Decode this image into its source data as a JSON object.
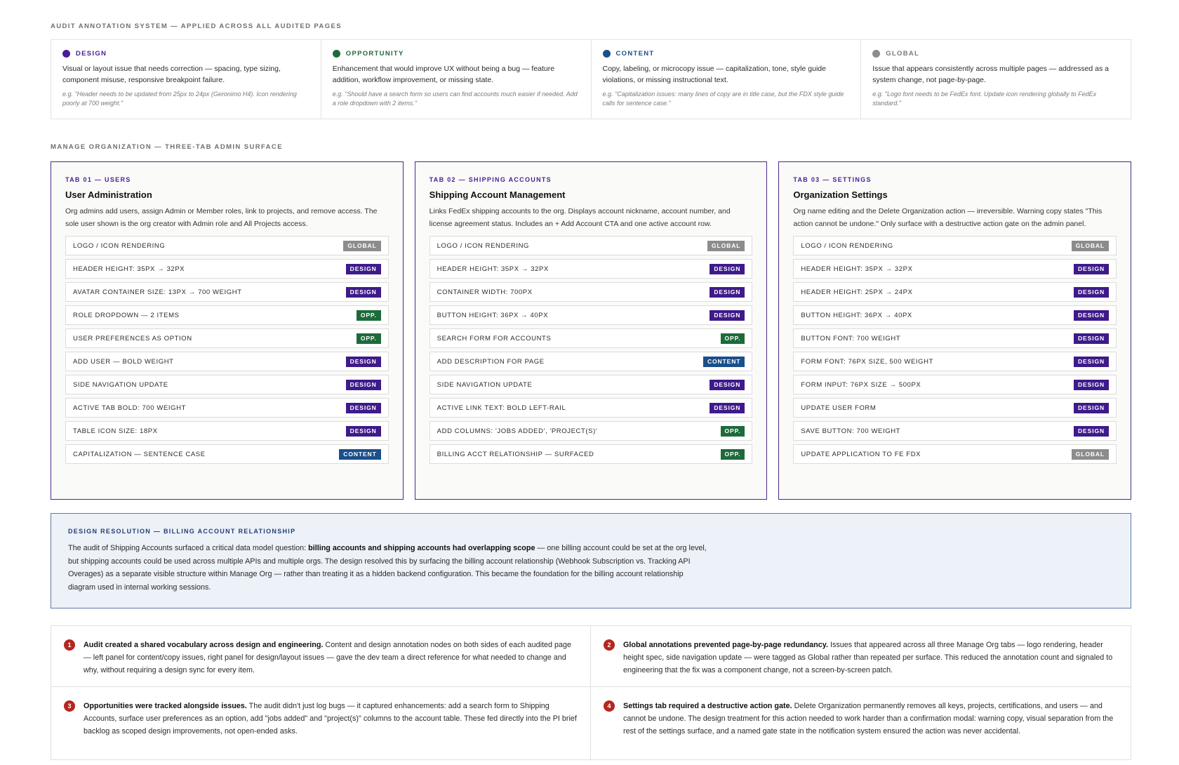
{
  "legend": {
    "section_label": "AUDIT ANNOTATION SYSTEM — APPLIED ACROSS ALL AUDITED PAGES",
    "items": [
      {
        "title": "DESIGN",
        "color": "#4a1d96",
        "desc": "Visual or layout issue that needs correction — spacing, type sizing, component misuse, responsive breakpoint failure.",
        "example": "e.g. \"Header needs to be updated from 25px to 24px (Geronimo H4). Icon rendering poorly at 700 weight.\""
      },
      {
        "title": "OPPORTUNITY",
        "color": "#1d6b3a",
        "desc": "Enhancement that would improve UX without being a bug — feature addition, workflow improvement, or missing state.",
        "example": "e.g. \"Should have a search form so users can find accounts much easier if needed. Add a role dropdown with 2 items.\""
      },
      {
        "title": "CONTENT",
        "color": "#1b4f8a",
        "desc": "Copy, labeling, or microcopy issue — capitalization, tone, style guide violations, or missing instructional text.",
        "example": "e.g. \"Capitalization issues: many lines of copy are in title case, but the FDX style guide calls for sentence case.\""
      },
      {
        "title": "GLOBAL",
        "color": "#8c8c8c",
        "desc": "Issue that appears consistently across multiple pages — addressed as a system change, not page-by-page.",
        "example": "e.g. \"Logo font needs to be FedEx font. Update icon rendering globally to FedEx standard.\""
      }
    ]
  },
  "manage": {
    "section_label": "MANAGE ORGANIZATION — THREE-TAB ADMIN SURFACE",
    "tabs": [
      {
        "kicker": "TAB 01 — USERS",
        "title": "User Administration",
        "desc": "Org admins add users, assign Admin or Member roles, link to projects, and remove access. The sole user shown is the org creator with Admin role and All Projects access.",
        "issues": [
          {
            "label": "LOGO / ICON RENDERING",
            "badge": "GLOBAL",
            "type": "global"
          },
          {
            "label": "HEADER HEIGHT: 35PX → 32PX",
            "badge": "DESIGN",
            "type": "design"
          },
          {
            "label": "AVATAR CONTAINER SIZE: 13PX → 700 WEIGHT",
            "badge": "DESIGN",
            "type": "design"
          },
          {
            "label": "ROLE DROPDOWN — 2 ITEMS",
            "badge": "OPP.",
            "type": "opp"
          },
          {
            "label": "USER PREFERENCES AS OPTION",
            "badge": "OPP.",
            "type": "opp"
          },
          {
            "label": "ADD USER — BOLD WEIGHT",
            "badge": "DESIGN",
            "type": "design"
          },
          {
            "label": "SIDE NAVIGATION UPDATE",
            "badge": "DESIGN",
            "type": "design"
          },
          {
            "label": "ACTIVE TAB BOLD: 700 WEIGHT",
            "badge": "DESIGN",
            "type": "design"
          },
          {
            "label": "TABLE ICON SIZE: 18PX",
            "badge": "DESIGN",
            "type": "design"
          },
          {
            "label": "CAPITALIZATION — SENTENCE CASE",
            "badge": "CONTENT",
            "type": "content"
          }
        ]
      },
      {
        "kicker": "TAB 02 — SHIPPING ACCOUNTS",
        "title": "Shipping Account Management",
        "desc": "Links FedEx shipping accounts to the org. Displays account nickname, account number, and license agreement status. Includes an + Add Account CTA and one active account row.",
        "issues": [
          {
            "label": "LOGO / ICON RENDERING",
            "badge": "GLOBAL",
            "type": "global"
          },
          {
            "label": "HEADER HEIGHT: 35PX → 32PX",
            "badge": "DESIGN",
            "type": "design"
          },
          {
            "label": "CONTAINER WIDTH: 700PX",
            "badge": "DESIGN",
            "type": "design"
          },
          {
            "label": "BUTTON HEIGHT: 36PX → 40PX",
            "badge": "DESIGN",
            "type": "design"
          },
          {
            "label": "SEARCH FORM FOR ACCOUNTS",
            "badge": "OPP.",
            "type": "opp"
          },
          {
            "label": "ADD DESCRIPTION FOR PAGE",
            "badge": "CONTENT",
            "type": "content"
          },
          {
            "label": "SIDE NAVIGATION UPDATE",
            "badge": "DESIGN",
            "type": "design"
          },
          {
            "label": "ACTIVE LINK TEXT: BOLD LEFT-RAIL",
            "badge": "DESIGN",
            "type": "design"
          },
          {
            "label": "ADD COLUMNS: 'JOBS ADDED', 'PROJECT(S)'",
            "badge": "OPP.",
            "type": "opp"
          },
          {
            "label": "BILLING ACCT RELATIONSHIP — SURFACED",
            "badge": "OPP.",
            "type": "opp"
          }
        ]
      },
      {
        "kicker": "TAB 03 — SETTINGS",
        "title": "Organization Settings",
        "desc": "Org name editing and the Delete Organization action — irreversible. Warning copy states \"This action cannot be undone.\" Only surface with a destructive action gate on the admin panel.",
        "issues": [
          {
            "label": "LOGO / ICON RENDERING",
            "badge": "GLOBAL",
            "type": "global"
          },
          {
            "label": "HEADER HEIGHT: 35PX → 32PX",
            "badge": "DESIGN",
            "type": "design"
          },
          {
            "label": "HEADER HEIGHT: 25PX → 24PX",
            "badge": "DESIGN",
            "type": "design"
          },
          {
            "label": "BUTTON HEIGHT: 36PX → 40PX",
            "badge": "DESIGN",
            "type": "design"
          },
          {
            "label": "BUTTON FONT: 700 WEIGHT",
            "badge": "DESIGN",
            "type": "design"
          },
          {
            "label": "FORM FONT: 76PX SIZE, 500 WEIGHT",
            "badge": "DESIGN",
            "type": "design"
          },
          {
            "label": "FORM INPUT: 76PX SIZE → 500PX",
            "badge": "DESIGN",
            "type": "design"
          },
          {
            "label": "UPDATE USER FORM",
            "badge": "DESIGN",
            "type": "design"
          },
          {
            "label": "SAVE BUTTON: 700 WEIGHT",
            "badge": "DESIGN",
            "type": "design"
          },
          {
            "label": "UPDATE APPLICATION TO FE FDX",
            "badge": "GLOBAL",
            "type": "global"
          }
        ]
      }
    ]
  },
  "resolution": {
    "kicker": "DESIGN RESOLUTION — BILLING ACCOUNT RELATIONSHIP",
    "lead": "The audit of Shipping Accounts surfaced a critical data model question: ",
    "bold": "billing accounts and shipping accounts had overlapping scope",
    "rest": " — one billing account could be set at the org level, but shipping accounts could be used across multiple APIs and multiple orgs. The design resolved this by surfacing the billing account relationship (Webhook Subscription vs. Tracking API Overages) as a separate visible structure within Manage Org — rather than treating it as a hidden backend configuration. This became the foundation for the billing account relationship diagram used in internal working sessions."
  },
  "findings": [
    {
      "num": "1",
      "bold": "Audit created a shared vocabulary across design and engineering.",
      "text": " Content and design annotation nodes on both sides of each audited page — left panel for content/copy issues, right panel for design/layout issues — gave the dev team a direct reference for what needed to change and why, without requiring a design sync for every item."
    },
    {
      "num": "2",
      "bold": "Global annotations prevented page-by-page redundancy.",
      "text": " Issues that appeared across all three Manage Org tabs — logo rendering, header height spec, side navigation update — were tagged as Global rather than repeated per surface. This reduced the annotation count and signaled to engineering that the fix was a component change, not a screen-by-screen patch."
    },
    {
      "num": "3",
      "bold": "Opportunities were tracked alongside issues.",
      "text": " The audit didn't just log bugs — it captured enhancements: add a search form to Shipping Accounts, surface user preferences as an option, add \"jobs added\" and \"project(s)\" columns to the account table. These fed directly into the PI brief backlog as scoped design improvements, not open-ended asks."
    },
    {
      "num": "4",
      "bold": "Settings tab required a destructive action gate.",
      "text": " Delete Organization permanently removes all keys, projects, certifications, and users — and cannot be undone. The design treatment for this action needed to work harder than a confirmation modal: warning copy, visual separation from the rest of the settings surface, and a named gate state in the notification system ensured the action was never accidental."
    }
  ]
}
